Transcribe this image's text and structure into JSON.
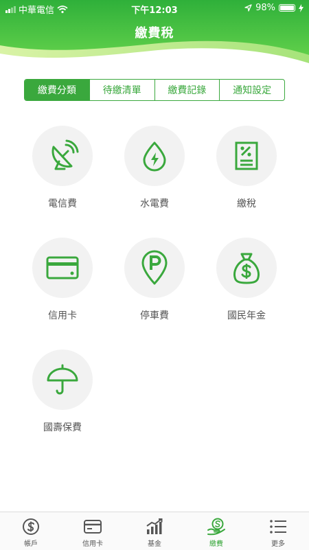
{
  "status_bar": {
    "carrier": "中華電信",
    "time": "下午12:03",
    "battery_percent": "98%",
    "battery_level": 0.98,
    "icons": [
      "signal-icon",
      "wifi-icon",
      "location-arrow-icon",
      "battery-icon",
      "charging-icon"
    ]
  },
  "header": {
    "title": "繳費稅",
    "accent": "#3aa83d"
  },
  "segments": [
    {
      "label": "繳費分類",
      "active": true
    },
    {
      "label": "待繳清單",
      "active": false
    },
    {
      "label": "繳費記錄",
      "active": false
    },
    {
      "label": "通知設定",
      "active": false
    }
  ],
  "categories": [
    {
      "label": "電信費",
      "icon": "satellite-dish-icon"
    },
    {
      "label": "水電費",
      "icon": "water-drop-bolt-icon"
    },
    {
      "label": "繳稅",
      "icon": "tax-document-icon"
    },
    {
      "label": "信用卡",
      "icon": "credit-card-icon"
    },
    {
      "label": "停車費",
      "icon": "parking-pin-icon"
    },
    {
      "label": "國民年金",
      "icon": "money-bag-icon"
    },
    {
      "label": "國壽保費",
      "icon": "umbrella-icon"
    }
  ],
  "tab_bar": [
    {
      "label": "帳戶",
      "icon": "dollar-circle-icon",
      "active": false
    },
    {
      "label": "信用卡",
      "icon": "card-icon",
      "active": false
    },
    {
      "label": "基金",
      "icon": "chart-growth-icon",
      "active": false
    },
    {
      "label": "繳費",
      "icon": "pay-hand-icon",
      "active": true
    },
    {
      "label": "更多",
      "icon": "list-menu-icon",
      "active": false
    }
  ]
}
